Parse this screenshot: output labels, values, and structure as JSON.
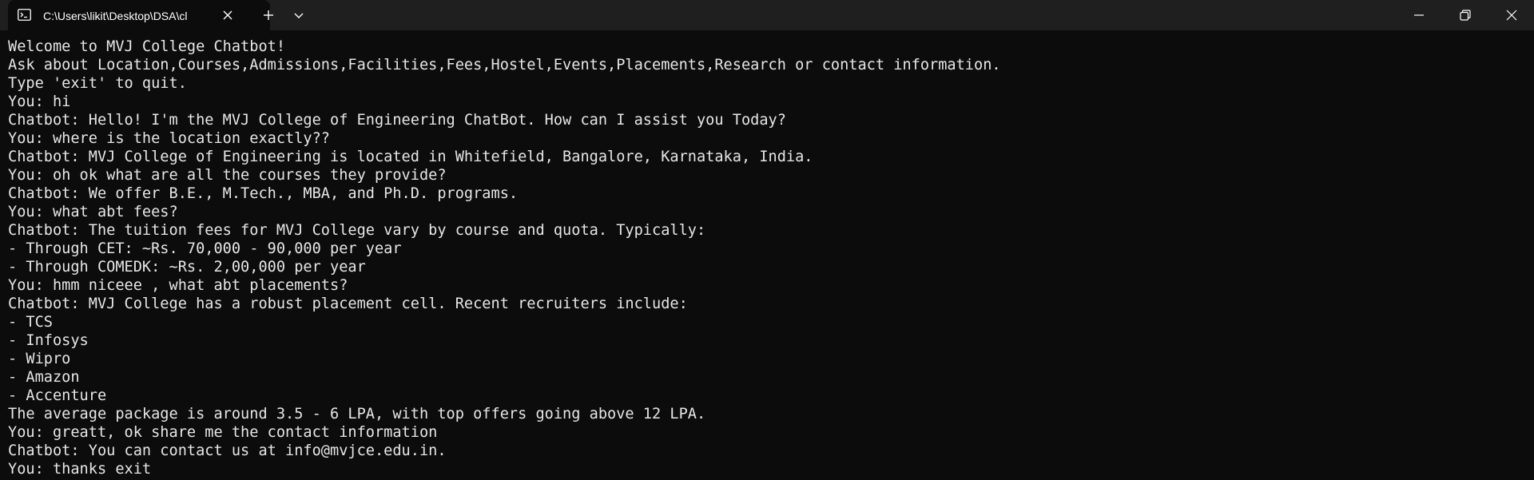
{
  "window": {
    "tab_title": "C:\\Users\\likit\\Desktop\\DSA\\cl",
    "icons": {
      "tab": "terminal-icon",
      "tab_close": "close-icon",
      "new_tab": "plus-icon",
      "dropdown": "chevron-down-icon",
      "minimize": "minimize-icon",
      "maximize": "restore-icon",
      "close": "close-icon"
    }
  },
  "console": {
    "lines": [
      "Welcome to MVJ College Chatbot!",
      "Ask about Location,Courses,Admissions,Facilities,Fees,Hostel,Events,Placements,Research or contact information.",
      "Type 'exit' to quit.",
      "You: hi",
      "Chatbot: Hello! I'm the MVJ College of Engineering ChatBot. How can I assist you Today?",
      "You: where is the location exactly??",
      "Chatbot: MVJ College of Engineering is located in Whitefield, Bangalore, Karnataka, India.",
      "You: oh ok what are all the courses they provide?",
      "Chatbot: We offer B.E., M.Tech., MBA, and Ph.D. programs.",
      "You: what abt fees?",
      "Chatbot: The tuition fees for MVJ College vary by course and quota. Typically:",
      "- Through CET: ~Rs. 70,000 - 90,000 per year",
      "- Through COMEDK: ~Rs. 2,00,000 per year",
      "You: hmm niceee , what abt placements?",
      "Chatbot: MVJ College has a robust placement cell. Recent recruiters include:",
      "- TCS",
      "- Infosys",
      "- Wipro",
      "- Amazon",
      "- Accenture",
      "The average package is around 3.5 - 6 LPA, with top offers going above 12 LPA.",
      "You: greatt, ok share me the contact information",
      "Chatbot: You can contact us at info@mvjce.edu.in.",
      "You: thanks exit"
    ]
  },
  "colors": {
    "background": "#0c0c0c",
    "tabbar": "#1f1f1f",
    "text": "#e6e6e6"
  }
}
